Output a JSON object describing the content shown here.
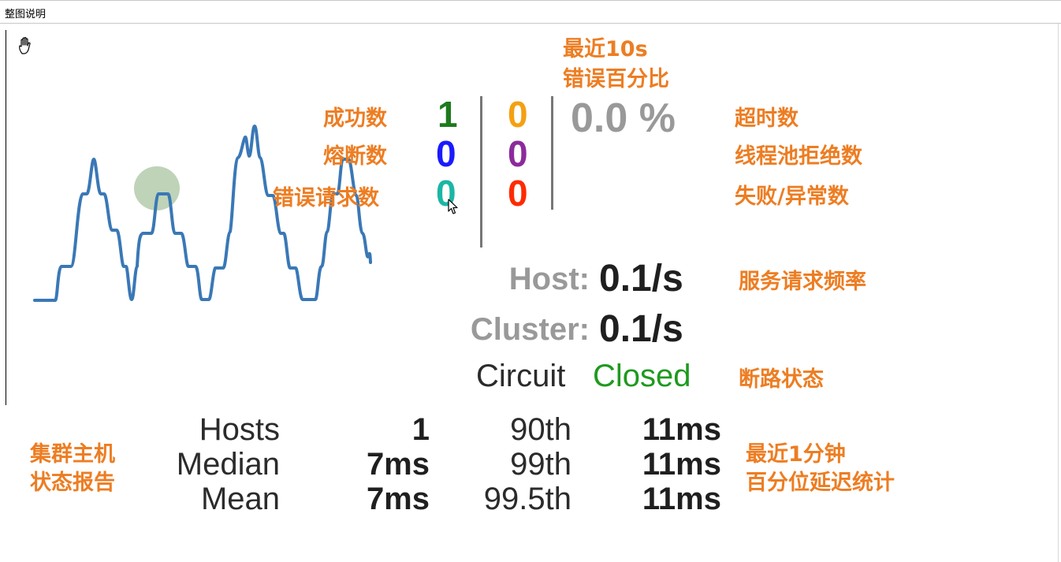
{
  "window": {
    "title": "整图说明"
  },
  "annotations": {
    "error_pct_note_line1": "最近10s",
    "error_pct_note_line2": "错误百分比",
    "success": "成功数",
    "short_circuited": "熔断数",
    "bad_request": "错误请求数",
    "timeout": "超时数",
    "rejected": "线程池拒绝数",
    "failure": "失败/异常数",
    "rate": "服务请求频率",
    "circuit_state": "断路状态",
    "hosts_report_line1": "集群主机",
    "hosts_report_line2": "状态报告",
    "percentile_line1": "最近1分钟",
    "percentile_line2": "百分位延迟统计"
  },
  "counters": {
    "success": "1",
    "short_circuited": "0",
    "bad_request": "0",
    "timeout": "0",
    "rejected": "0",
    "failure": "0",
    "error_percentage": "0.0 %"
  },
  "rates": {
    "host_label": "Host:",
    "host_value": "0.1/s",
    "cluster_label": "Cluster:",
    "cluster_value": "0.1/s"
  },
  "circuit": {
    "label": "Circuit",
    "status": "Closed"
  },
  "stats": {
    "rows": [
      {
        "label": "Hosts",
        "value": "1",
        "pct": "90th",
        "pct_value": "11ms"
      },
      {
        "label": "Median",
        "value": "7ms",
        "pct": "99th",
        "pct_value": "11ms"
      },
      {
        "label": "Mean",
        "value": "7ms",
        "pct": "99.5th",
        "pct_value": "11ms"
      }
    ]
  },
  "colors": {
    "annotation": "#ed7d22",
    "success": "#1e7a1e",
    "timeout": "#f4a011",
    "short_circuited": "#1a1aff",
    "rejected": "#8c2a9c",
    "bad_request": "#1bb6a4",
    "failure": "#ff2a00",
    "closed": "#1e9a1e",
    "sparkline": "#3a78b6",
    "circle": "#a8c4a0"
  },
  "icons": {
    "cursor": "hand-cursor-icon",
    "pointer": "mouse-pointer-icon"
  }
}
